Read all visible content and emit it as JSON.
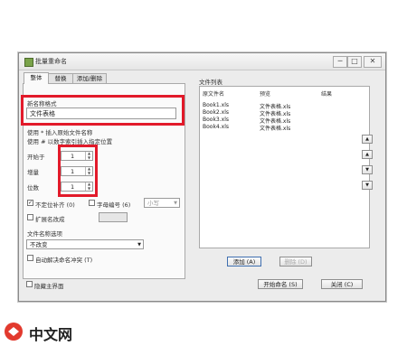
{
  "window": {
    "title": "批量重命名",
    "minimize": "─",
    "maximize": "□",
    "close": "✕"
  },
  "tabs": [
    {
      "label": "整体"
    },
    {
      "label": "替换"
    },
    {
      "label": "添加/删除"
    }
  ],
  "left": {
    "new_name_label": "新名称格式",
    "new_name_value": "文件表格",
    "hint1": "使用 * 插入原始文件名称",
    "hint2": "使用 # 以数字索引插入指定位置",
    "start_label": "开始于",
    "start_value": "1",
    "step_label": "增量",
    "step_value": "1",
    "digits_label": "位数",
    "digits_value": "1",
    "uncertain_digits_label": "不定位补齐 (0)",
    "letter_index_label": "字母编号 (6)",
    "letter_case_value": "小写",
    "ext_label": "扩展名改成",
    "ext_value": "",
    "case_label": "文件名称选项",
    "case_value": "不改变",
    "auto_resolve_label": "自动解决命名冲突 (T)"
  },
  "right": {
    "list_label": "文件列表",
    "columns": [
      "原文件名",
      "预览",
      "结果"
    ],
    "rows": [
      {
        "original": "Book1.xls",
        "preview": "文件表格.xls"
      },
      {
        "original": "Book2.xls",
        "preview": "文件表格.xls"
      },
      {
        "original": "Book3.xls",
        "preview": "文件表格.xls"
      },
      {
        "original": "Book4.xls",
        "preview": "文件表格.xls"
      }
    ],
    "add_button": "添加 (A)",
    "remove_button": "删除 (D)",
    "side_buttons": [
      "▲",
      "▲",
      "▼",
      "▼"
    ]
  },
  "footer": {
    "hide_main_label": "隐藏主界面",
    "start_button": "开始命名 (S)",
    "close_button": "关闭 (C)"
  },
  "watermark": {
    "text": "中文网",
    "logo": "php"
  },
  "colors": {
    "highlight": "#e21a2a",
    "accent": "#3f6fb0"
  }
}
